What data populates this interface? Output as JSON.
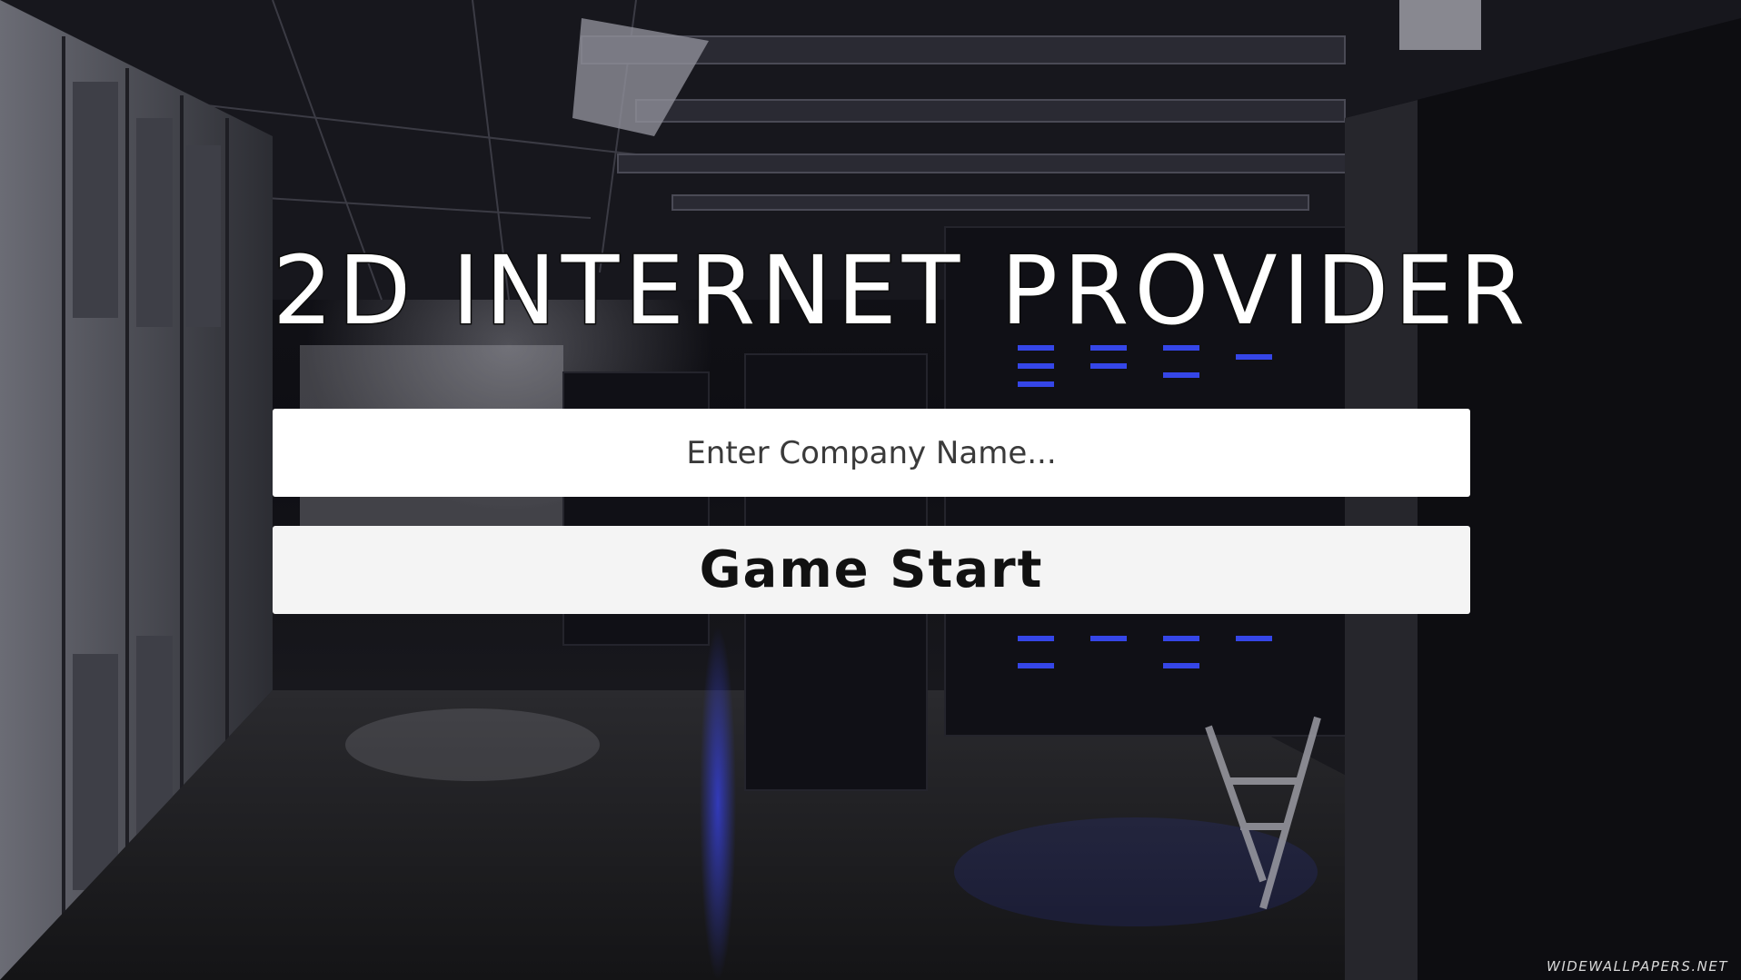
{
  "game": {
    "title": "2D INTERNET PROVIDER",
    "company_input": {
      "placeholder": "Enter Company Name...",
      "value": ""
    },
    "start_button_label": "Game Start",
    "background_watermark": "WIDEWALLPAPERS.NET"
  },
  "colors": {
    "title_text": "#ffffff",
    "input_background": "#ffffff",
    "button_background": "#f4f4f4",
    "server_led": "#3a4cff"
  }
}
